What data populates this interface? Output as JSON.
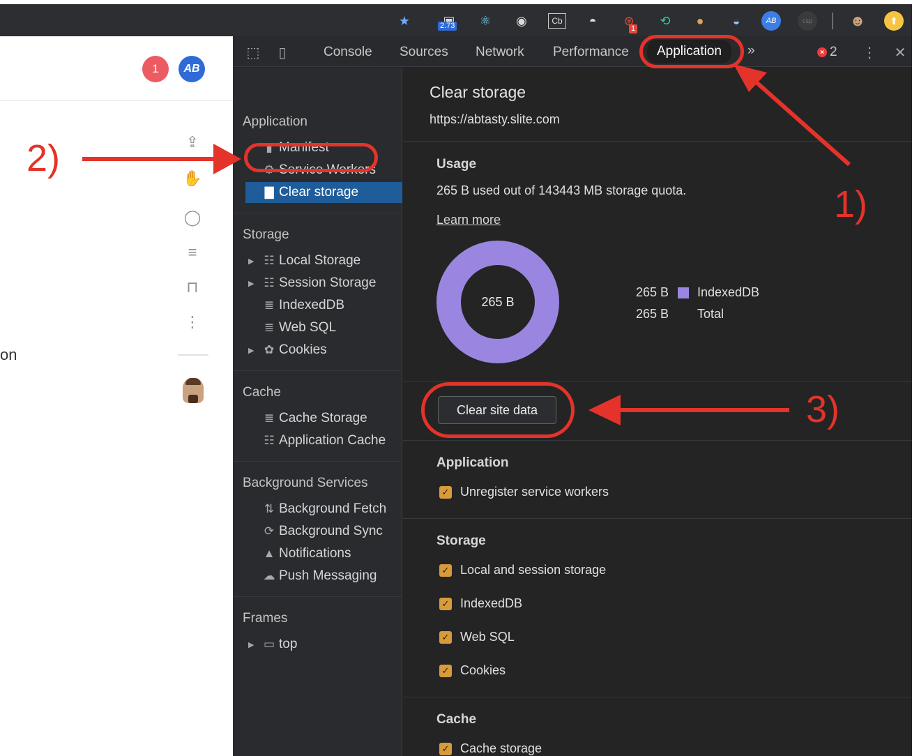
{
  "toolbar": {
    "extensions": [
      {
        "name": "bookmark-star-icon",
        "glyph": "★"
      },
      {
        "name": "speed-extension-icon",
        "glyph": "▣",
        "badge": "2.73"
      },
      {
        "name": "react-devtools-icon",
        "glyph": "⚛"
      },
      {
        "name": "drop-extension-icon",
        "glyph": "◉"
      },
      {
        "name": "cb-extension-icon",
        "glyph": "Cb"
      },
      {
        "name": "spy-extension-icon",
        "glyph": "◓"
      },
      {
        "name": "fingerprint-extension-icon",
        "glyph": "⊛",
        "badge": "1"
      },
      {
        "name": "redux-extension-icon",
        "glyph": "⟲"
      },
      {
        "name": "cookie-extension-icon",
        "glyph": "●"
      },
      {
        "name": "wave-extension-icon",
        "glyph": "◒"
      },
      {
        "name": "abtasty-extension-icon",
        "glyph": "AB"
      },
      {
        "name": "csp-extension-icon",
        "glyph": "csp"
      },
      {
        "name": "profile-avatar-icon",
        "glyph": "☻"
      },
      {
        "name": "update-arrow-icon",
        "glyph": "⬆"
      }
    ]
  },
  "webpage": {
    "notification_count": "1",
    "avatar_initials": "AB",
    "partial_text": "on"
  },
  "devtools": {
    "tabs": [
      {
        "label": "Console"
      },
      {
        "label": "Sources"
      },
      {
        "label": "Network"
      },
      {
        "label": "Performance"
      },
      {
        "label": "Application",
        "active": true
      }
    ],
    "more_tabs": "»",
    "error_count": "2",
    "sidebar": {
      "sections": [
        {
          "title": "Application",
          "items": [
            {
              "label": "Manifest",
              "icon": "file-icon",
              "glyph": "▮"
            },
            {
              "label": "Service Workers",
              "icon": "gear-icon",
              "glyph": "⚙"
            },
            {
              "label": "Clear storage",
              "icon": "trash-icon",
              "glyph": "🗑",
              "selected": true
            }
          ]
        },
        {
          "title": "Storage",
          "items": [
            {
              "label": "Local Storage",
              "icon": "grid-icon",
              "glyph": "☷",
              "expandable": true
            },
            {
              "label": "Session Storage",
              "icon": "grid-icon",
              "glyph": "☷",
              "expandable": true
            },
            {
              "label": "IndexedDB",
              "icon": "database-icon",
              "glyph": "≣"
            },
            {
              "label": "Web SQL",
              "icon": "database-icon",
              "glyph": "≣"
            },
            {
              "label": "Cookies",
              "icon": "cookie-icon",
              "glyph": "✿",
              "expandable": true
            }
          ]
        },
        {
          "title": "Cache",
          "items": [
            {
              "label": "Cache Storage",
              "icon": "database-icon",
              "glyph": "≣"
            },
            {
              "label": "Application Cache",
              "icon": "grid-icon",
              "glyph": "☷"
            }
          ]
        },
        {
          "title": "Background Services",
          "items": [
            {
              "label": "Background Fetch",
              "icon": "updown-arrow-icon",
              "glyph": "⇅"
            },
            {
              "label": "Background Sync",
              "icon": "sync-icon",
              "glyph": "⟳"
            },
            {
              "label": "Notifications",
              "icon": "bell-icon",
              "glyph": "🔔"
            },
            {
              "label": "Push Messaging",
              "icon": "cloud-icon",
              "glyph": "☁"
            }
          ]
        },
        {
          "title": "Frames",
          "items": [
            {
              "label": "top",
              "icon": "frame-icon",
              "glyph": "▭",
              "expandable": true
            }
          ]
        }
      ]
    },
    "main": {
      "title": "Clear storage",
      "url": "https://abtasty.slite.com",
      "usage_heading": "Usage",
      "usage_text": "265 B used out of 143443 MB storage quota.",
      "learn_more": "Learn more",
      "donut_label": "265 B",
      "legend": [
        {
          "value": "265 B",
          "label": "IndexedDB",
          "color": "#9a86e0"
        },
        {
          "value": "265 B",
          "label": "Total",
          "color": ""
        }
      ],
      "clear_button": "Clear site data",
      "groups": [
        {
          "heading": "Application",
          "checks": [
            "Unregister service workers"
          ]
        },
        {
          "heading": "Storage",
          "checks": [
            "Local and session storage",
            "IndexedDB",
            "Web SQL",
            "Cookies"
          ]
        },
        {
          "heading": "Cache",
          "checks": [
            "Cache storage"
          ]
        }
      ]
    }
  },
  "annotations": {
    "step1": "1)",
    "step2": "2)",
    "step3": "3)",
    "color": "#e4332a"
  }
}
